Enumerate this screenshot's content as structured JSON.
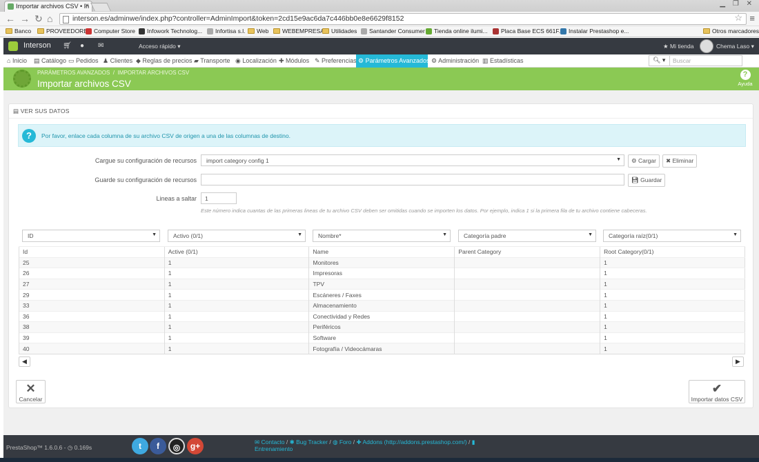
{
  "browser": {
    "tab_title": "Importar archivos CSV • In",
    "url": "interson.es/adminwe/index.php?controller=AdminImport&token=2cd15e9ac6da7c446bb0e8e6629f8152",
    "bookmarks": [
      "Banco",
      "PROVEEDORES",
      "Computer Store",
      "Infowork Technolog...",
      "Infortisa s.l.",
      "Web",
      "WEBEMPRESA",
      "Utilidades",
      "Santander Consumer",
      "Tienda online ilumi...",
      "Placa Base ECS 661F...",
      "Instalar Prestashop e..."
    ],
    "other_bookmarks": "Otros marcadores"
  },
  "header": {
    "brand": "Interson",
    "quick_access": "Acceso rápido",
    "my_store": "Mi tienda",
    "user": "Chema Laso"
  },
  "nav": {
    "items": [
      "Inicio",
      "Catálogo",
      "Pedidos",
      "Clientes",
      "Reglas de precios",
      "Transporte",
      "Localización",
      "Módulos",
      "Preferencias",
      "Parámetros Avanzados",
      "Administración",
      "Estadísticas"
    ],
    "search_placeholder": "Buscar"
  },
  "page": {
    "breadcrumb": [
      "PARÁMETROS AVANZADOS",
      "IMPORTAR ARCHIVOS CSV"
    ],
    "title": "Importar archivos CSV",
    "help": "Ayuda"
  },
  "panel": {
    "heading": "VER SUS DATOS",
    "alert": "Por favor, enlace cada columna de su archivo CSV de origen a una de las columnas de destino.",
    "load_config_label": "Cargue su configuración de recursos",
    "load_config_value": "import category config 1",
    "load_button": "Cargar",
    "delete_button": "Eliminar",
    "save_config_label": "Guarde su configuración de recursos",
    "save_config_value": "",
    "save_button": "Guardar",
    "skip_label": "Lineas a saltar",
    "skip_value": "1",
    "skip_hint": "Este número indica cuantas de las primeras lineas de tu archivo CSV deben ser omitidas cuando se importen los datos. Por ejemplo, indica 1 si la primera fila de tu archivo contiene cabeceras.",
    "column_selects": [
      "ID",
      "Activo (0/1)",
      "Nombre*",
      "Categoría padre",
      "Categoría raíz(0/1)"
    ],
    "table_headers": [
      "Id",
      "Active (0/1)",
      "Name",
      "Parent Category",
      "Root Category(0/1)"
    ],
    "rows": [
      [
        "25",
        "1",
        "Monitores",
        "",
        "1"
      ],
      [
        "26",
        "1",
        "Impresoras",
        "",
        "1"
      ],
      [
        "27",
        "1",
        "TPV",
        "",
        "1"
      ],
      [
        "29",
        "1",
        "Escáneres / Faxes",
        "",
        "1"
      ],
      [
        "33",
        "1",
        "Almacenamiento",
        "",
        "1"
      ],
      [
        "36",
        "1",
        "Conectividad y Redes",
        "",
        "1"
      ],
      [
        "38",
        "1",
        "Periféricos",
        "",
        "1"
      ],
      [
        "39",
        "1",
        "Software",
        "",
        "1"
      ],
      [
        "40",
        "1",
        "Fotografía / Videocámaras",
        "",
        "1"
      ]
    ],
    "cancel_button": "Cancelar",
    "import_button": "Importar datos CSV"
  },
  "footer": {
    "version": "PrestaShop™ 1.6.0.6 -",
    "load_time": "0.169s",
    "links": [
      "Contacto",
      "Bug Tracker",
      "Foro",
      "Addons (http://addons.prestashop.com/)",
      "Entrenamiento"
    ]
  }
}
